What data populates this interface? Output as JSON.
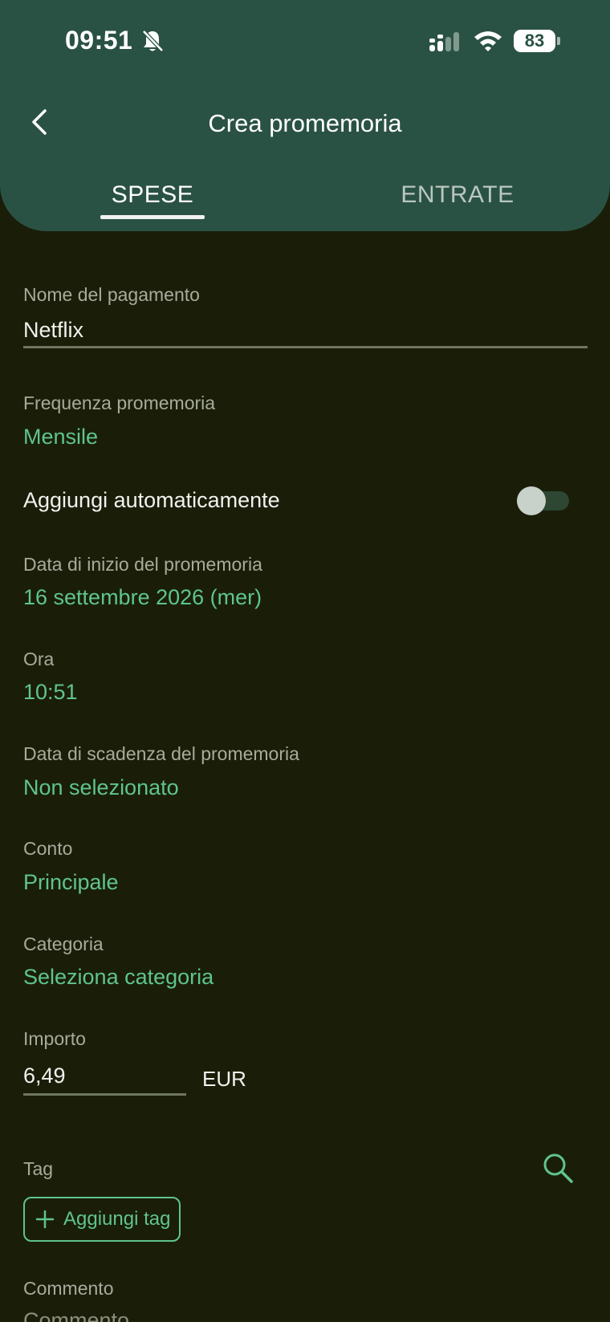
{
  "status_bar": {
    "time": "09:51",
    "battery": "83"
  },
  "header": {
    "title": "Crea promemoria",
    "tabs": [
      {
        "label": "SPESE",
        "active": true
      },
      {
        "label": "ENTRATE",
        "active": false
      }
    ]
  },
  "form": {
    "payment_name": {
      "label": "Nome del pagamento",
      "value": "Netflix"
    },
    "frequency": {
      "label": "Frequenza promemoria",
      "value": "Mensile"
    },
    "auto_add": {
      "label": "Aggiungi automaticamente",
      "enabled": false
    },
    "start_date": {
      "label": "Data di inizio del promemoria",
      "value": "16 settembre 2026 (mer)"
    },
    "time": {
      "label": "Ora",
      "value": "10:51"
    },
    "end_date": {
      "label": "Data di scadenza del promemoria",
      "value": "Non selezionato"
    },
    "account": {
      "label": "Conto",
      "value": "Principale"
    },
    "category": {
      "label": "Categoria",
      "value": "Seleziona categoria"
    },
    "amount": {
      "label": "Importo",
      "value": "6,49",
      "currency": "EUR"
    },
    "tag": {
      "label": "Tag",
      "add_button": "Aggiungi tag"
    },
    "comment": {
      "label": "Commento",
      "placeholder": "Commento"
    }
  },
  "colors": {
    "header_bg": "#2a5244",
    "page_bg": "#1a1e09",
    "accent": "#5fc48e"
  },
  "icons": [
    "bell-off-icon",
    "signal-icon",
    "wifi-icon",
    "battery-icon",
    "back-arrow-icon",
    "search-icon",
    "plus-icon"
  ]
}
